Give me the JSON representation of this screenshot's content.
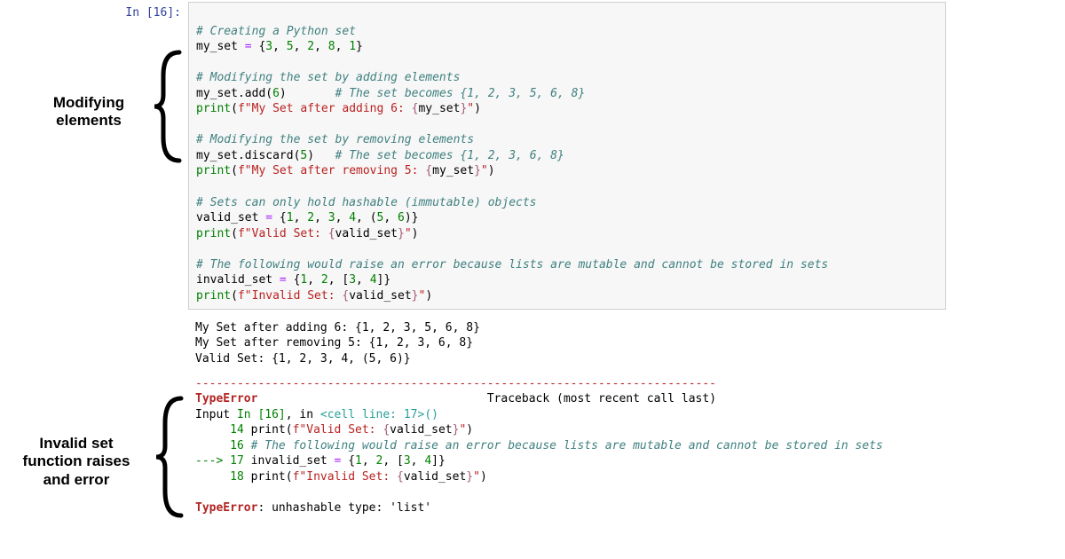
{
  "prompt": "In [16]:",
  "code": {
    "l1_comment": "# Creating a Python set",
    "l2_pre": "my_set ",
    "l2_eq": "=",
    "l2_post": " {",
    "l2_n1": "3",
    "l2_n2": "5",
    "l2_n3": "2",
    "l2_n4": "8",
    "l2_n5": "1",
    "l2_close": "}",
    "l3_blank": "",
    "l4_comment": "# Modifying the set by adding elements",
    "l5_pre": "my_set.add(",
    "l5_num": "6",
    "l5_post": ")       ",
    "l5_comment": "# The set becomes {1, 2, 3, 5, 6, 8}",
    "l6_func": "print",
    "l6_p1": "(",
    "l6_fpre": "f\"My Set after adding 6: ",
    "l6_lb": "{",
    "l6_var": "my_set",
    "l6_rb": "}",
    "l6_end": "\"",
    "l6_p2": ")",
    "l7_blank": "",
    "l8_comment": "# Modifying the set by removing elements",
    "l9_pre": "my_set.discard(",
    "l9_num": "5",
    "l9_post": ")   ",
    "l9_comment": "# The set becomes {1, 2, 3, 6, 8}",
    "l10_func": "print",
    "l10_p1": "(",
    "l10_fpre": "f\"My Set after removing 5: ",
    "l10_lb": "{",
    "l10_var": "my_set",
    "l10_rb": "}",
    "l10_end": "\"",
    "l10_p2": ")",
    "l11_blank": "",
    "l12_comment": "# Sets can only hold hashable (immutable) objects",
    "l13_pre": "valid_set ",
    "l13_eq": "=",
    "l13_post": " {",
    "l13_n1": "1",
    "l13_n2": "2",
    "l13_n3": "3",
    "l13_n4": "4",
    "l13_n5": "5",
    "l13_n6": "6",
    "l13_close": ")}",
    "l13_tuple_open": ", (",
    "l14_func": "print",
    "l14_p1": "(",
    "l14_fpre": "f\"Valid Set: ",
    "l14_lb": "{",
    "l14_var": "valid_set",
    "l14_rb": "}",
    "l14_end": "\"",
    "l14_p2": ")",
    "l15_blank": "",
    "l16_comment": "# The following would raise an error because lists are mutable and cannot be stored in sets",
    "l17_pre": "invalid_set ",
    "l17_eq": "=",
    "l17_post": " {",
    "l17_n1": "1",
    "l17_n2": "2",
    "l17_n3": "3",
    "l17_n4": "4",
    "l17_close": "]}",
    "l17_list_open": ", [",
    "l18_func": "print",
    "l18_p1": "(",
    "l18_fpre": "f\"Invalid Set: ",
    "l18_lb": "{",
    "l18_var": "valid_set",
    "l18_rb": "}",
    "l18_end": "\"",
    "l18_p2": ")"
  },
  "output": {
    "o1": "My Set after adding 6: {1, 2, 3, 5, 6, 8}",
    "o2": "My Set after removing 5: {1, 2, 3, 6, 8}",
    "o3": "Valid Set: {1, 2, 3, 4, (5, 6)}"
  },
  "tb": {
    "dash": "---------------------------------------------------------------------------",
    "err_name": "TypeError",
    "tb_label": "Traceback (most recent call last)",
    "in_pre": "Input ",
    "in_mid": "In [16]",
    "in_post": ", in ",
    "cell": "<cell line: 17>",
    "cell_paren": "()",
    "l14_no": "     14 ",
    "l14_print": "print",
    "l14_rest1": "(",
    "l14_f": "f\"Valid Set: ",
    "l14_lb": "{",
    "l14_var": "valid_set",
    "l14_rb": "}",
    "l14_end": "\"",
    "l14_rest2": ")",
    "l16_no": "     16 ",
    "l16_comment": "# The following would raise an error because lists are mutable and cannot be stored in sets",
    "arrow": "---> ",
    "l17_no": "17 ",
    "l17_body": "invalid_set ",
    "l17_eq": "=",
    "l17_rest": " {",
    "l17_n1": "1",
    "l17_c1": ", ",
    "l17_n2": "2",
    "l17_c2": ", [",
    "l17_n3": "3",
    "l17_c3": ", ",
    "l17_n4": "4",
    "l17_close": "]}",
    "l18_no": "     18 ",
    "l18_print": "print",
    "l18_rest1": "(",
    "l18_f": "f\"Invalid Set: ",
    "l18_lb": "{",
    "l18_var": "valid_set",
    "l18_rb": "}",
    "l18_end": "\"",
    "l18_rest2": ")",
    "final_err": "TypeError",
    "final_msg": ": unhashable type: 'list'"
  },
  "annotations": {
    "a1_l1": "Modifying",
    "a1_l2": "elements",
    "a2_l1": "Invalid set",
    "a2_l2": "function raises",
    "a2_l3": "and error"
  }
}
